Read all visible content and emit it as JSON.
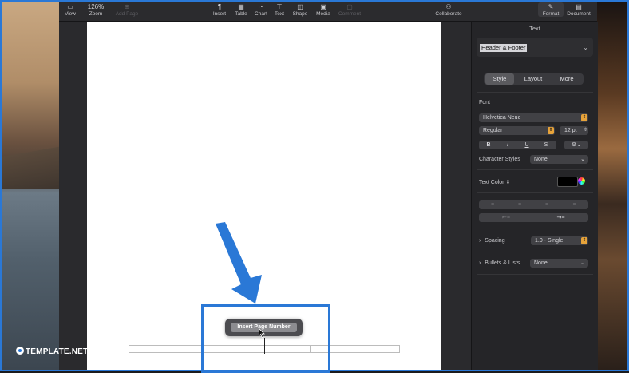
{
  "toolbar": {
    "view": "View",
    "zoom_value": "126%",
    "zoom": "Zoom",
    "add_page": "Add Page",
    "insert": "Insert",
    "table": "Table",
    "chart": "Chart",
    "text": "Text",
    "shape": "Shape",
    "media": "Media",
    "comment": "Comment",
    "collaborate": "Collaborate",
    "format": "Format",
    "document": "Document"
  },
  "popup": {
    "button_label": "Insert Page Number"
  },
  "panel": {
    "tab_title": "Text",
    "paragraph_style": "Header & Footer",
    "tabs": [
      "Style",
      "Layout",
      "More"
    ],
    "font_label": "Font",
    "font_family": "Helvetica Neue",
    "font_style": "Regular",
    "font_size": "12 pt",
    "style_buttons": [
      "B",
      "I",
      "U",
      "S"
    ],
    "character_styles_label": "Character Styles",
    "character_styles_value": "None",
    "text_color_label": "Text Color",
    "spacing_label": "Spacing",
    "spacing_value": "1.0 - Single",
    "bullets_label": "Bullets & Lists",
    "bullets_value": "None"
  },
  "watermark": {
    "brand": "TEMPLATE.NET"
  },
  "colors": {
    "accent": "#2a78d6",
    "stepper": "#e7a33a",
    "text_color_swatch": "#000000"
  }
}
